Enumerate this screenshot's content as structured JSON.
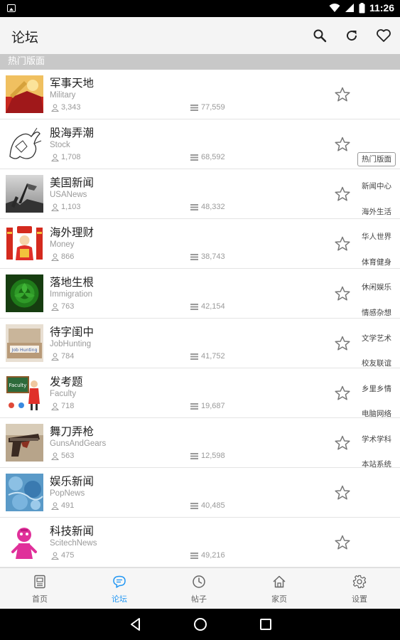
{
  "status_bar": {
    "time": "11:26"
  },
  "app_bar": {
    "title": "论坛",
    "actions": [
      "search-icon",
      "refresh-icon",
      "heart-icon"
    ]
  },
  "section_header": "热门版面",
  "forums": [
    {
      "name_cn": "军事天地",
      "name_en": "Military",
      "members": "3,343",
      "posts": "77,559"
    },
    {
      "name_cn": "股海弄潮",
      "name_en": "Stock",
      "members": "1,708",
      "posts": "68,592"
    },
    {
      "name_cn": "美国新闻",
      "name_en": "USANews",
      "members": "1,103",
      "posts": "48,332"
    },
    {
      "name_cn": "海外理财",
      "name_en": "Money",
      "members": "866",
      "posts": "38,743"
    },
    {
      "name_cn": "落地生根",
      "name_en": "Immigration",
      "members": "763",
      "posts": "42,154"
    },
    {
      "name_cn": "待字闺中",
      "name_en": "JobHunting",
      "members": "784",
      "posts": "41,752"
    },
    {
      "name_cn": "发考题",
      "name_en": "Faculty",
      "members": "718",
      "posts": "19,687"
    },
    {
      "name_cn": "舞刀弄枪",
      "name_en": "GunsAndGears",
      "members": "563",
      "posts": "12,598"
    },
    {
      "name_cn": "娱乐新闻",
      "name_en": "PopNews",
      "members": "491",
      "posts": "40,485"
    },
    {
      "name_cn": "科技新闻",
      "name_en": "ScitechNews",
      "members": "475",
      "posts": "49,216"
    }
  ],
  "thumb_text": {
    "job": "Job Hunting",
    "faculty": "Faculty"
  },
  "side_index": [
    "热门版面",
    "新闻中心",
    "海外生活",
    "华人世界",
    "体育健身",
    "休闲娱乐",
    "情感杂想",
    "文学艺术",
    "校友联谊",
    "乡里乡情",
    "电脑网络",
    "学术学科",
    "本站系统"
  ],
  "bottom_nav": [
    {
      "label": "首页",
      "icon": "home-page-icon",
      "active": false
    },
    {
      "label": "论坛",
      "icon": "chat-bubble-icon",
      "active": true
    },
    {
      "label": "帖子",
      "icon": "clock-icon",
      "active": false
    },
    {
      "label": "家页",
      "icon": "house-icon",
      "active": false
    },
    {
      "label": "设置",
      "icon": "gear-icon",
      "active": false
    }
  ],
  "colors": {
    "accent": "#2196f3",
    "section_header_bg": "#c8c8c8",
    "app_bar_bg": "#f4f4f4"
  }
}
